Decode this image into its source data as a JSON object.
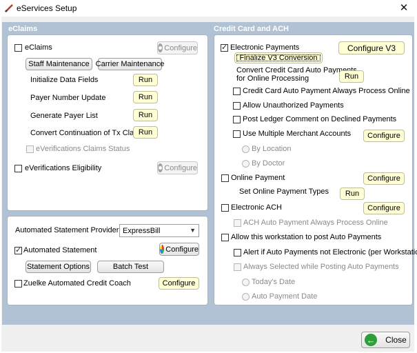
{
  "window": {
    "title": "eServices Setup"
  },
  "eclaims": {
    "header": "eClaims",
    "eclaims_label": "eClaims",
    "configure": "Configure",
    "staff_maintenance": "Staff Maintenance",
    "carrier_maintenance": "Carrier Maintenance",
    "tasks": [
      {
        "label": "Initialize Data Fields",
        "run": "Run"
      },
      {
        "label": "Payer Number Update",
        "run": "Run"
      },
      {
        "label": "Generate Payer List",
        "run": "Run"
      },
      {
        "label": "Convert Continuation of Tx Claims",
        "run": "Run"
      }
    ],
    "everifications_claims_status": "eVerifications Claims Status",
    "everifications_eligibility": "eVerifications Eligibility",
    "eligibility_configure": "Configure"
  },
  "statements": {
    "provider_label": "Automated Statement Provider",
    "provider_value": "ExpressBill",
    "automated_statement": "Automated Statement",
    "configure": "Configure",
    "statement_options": "Statement Options",
    "batch_test": "Batch Test",
    "credit_coach": "Zuelke Automated Credit Coach",
    "credit_coach_configure": "Configure"
  },
  "cc_ach": {
    "header": "Credit Card and ACH",
    "electronic_payments": "Electronic Payments",
    "configure_v3": "Configure V3",
    "finalize_v3": "Finalize V3 Conversion",
    "convert_line1": "Convert Credit Card Auto Payments",
    "convert_line2": "for Online Processing",
    "convert_run": "Run",
    "always_process_online": "Credit Card Auto Payment Always Process Online",
    "allow_unauthorized": "Allow Unauthorized Payments",
    "post_ledger_comment": "Post Ledger Comment on Declined Payments",
    "multiple_merchant": "Use Multiple Merchant Accounts",
    "multiple_merchant_configure": "Configure",
    "by_location": "By Location",
    "by_doctor": "By Doctor",
    "online_payment": "Online Payment",
    "online_payment_configure": "Configure",
    "set_online_payment_types": "Set Online Payment Types",
    "set_online_run": "Run",
    "electronic_ach": "Electronic ACH",
    "ach_configure": "Configure",
    "ach_always_online": "ACH Auto Payment Always Process Online",
    "allow_workstation": "Allow this workstation to post Auto Payments",
    "alert_not_electronic": "Alert if Auto Payments not Electronic (per Workstation)",
    "always_selected": "Always Selected while Posting Auto Payments",
    "todays_date": "Today's Date",
    "auto_payment_date": "Auto Payment Date"
  },
  "footer": {
    "close": "Close"
  }
}
